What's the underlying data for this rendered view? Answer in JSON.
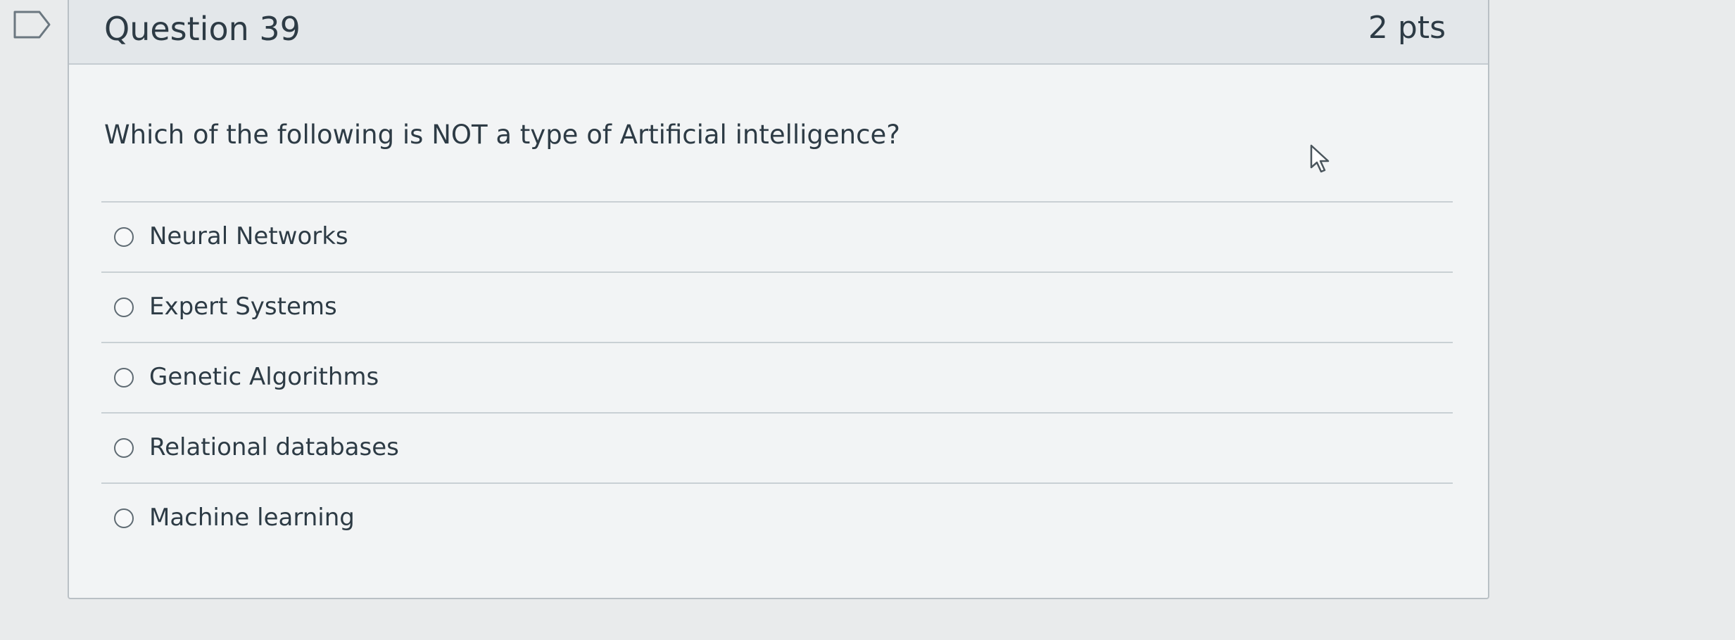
{
  "question": {
    "title": "Question 39",
    "points": "2 pts",
    "text": "Which of the following is NOT a type of Artificial intelligence?",
    "answers": [
      {
        "label": "Neural Networks",
        "selected": false
      },
      {
        "label": "Expert Systems",
        "selected": false
      },
      {
        "label": "Genetic Algorithms",
        "selected": false
      },
      {
        "label": "Relational databases",
        "selected": false
      },
      {
        "label": "Machine learning",
        "selected": false
      }
    ]
  },
  "icons": {
    "flag": "flag-question-icon",
    "cursor": "mouse-pointer-icon"
  },
  "colors": {
    "background": "#e9ebec",
    "header": "#e3e7ea",
    "card": "#f2f4f5",
    "text": "#2d3b45",
    "border": "#c9d0d4"
  }
}
